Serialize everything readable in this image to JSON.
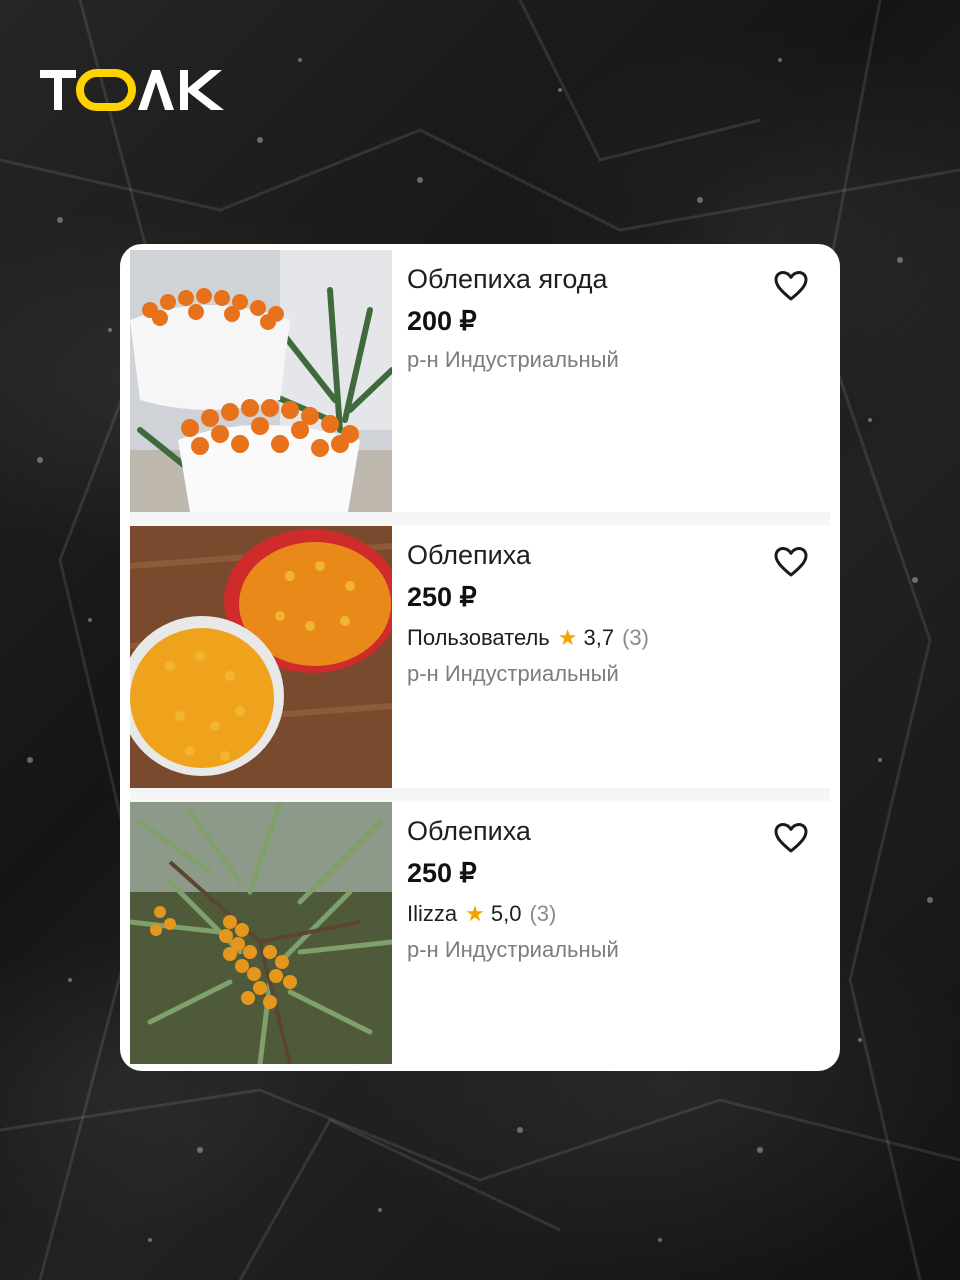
{
  "brand": {
    "logo_text": "ТОЛК",
    "accent_color": "#ffd200"
  },
  "listings": [
    {
      "title": "Облепиха ягода",
      "price": "200 ₽",
      "seller": null,
      "district": "р-н Индустриальный",
      "image": "sea-buckthorn-bowls",
      "favorite_icon": "heart-outline-icon"
    },
    {
      "title": "Облепиха",
      "price": "250 ₽",
      "seller": {
        "name": "Пользователь",
        "rating": "3,7",
        "reviews": "(3)"
      },
      "district": "р-н Индустриальный",
      "image": "sea-buckthorn-red-bowl",
      "favorite_icon": "heart-outline-icon"
    },
    {
      "title": "Облепиха",
      "price": "250 ₽",
      "seller": {
        "name": "Ilizza",
        "rating": "5,0",
        "reviews": "(3)"
      },
      "district": "р-н Индустриальный",
      "image": "sea-buckthorn-branch",
      "favorite_icon": "heart-outline-icon"
    }
  ],
  "colors": {
    "star": "#f5a300",
    "muted_text": "#7d7d7d"
  }
}
